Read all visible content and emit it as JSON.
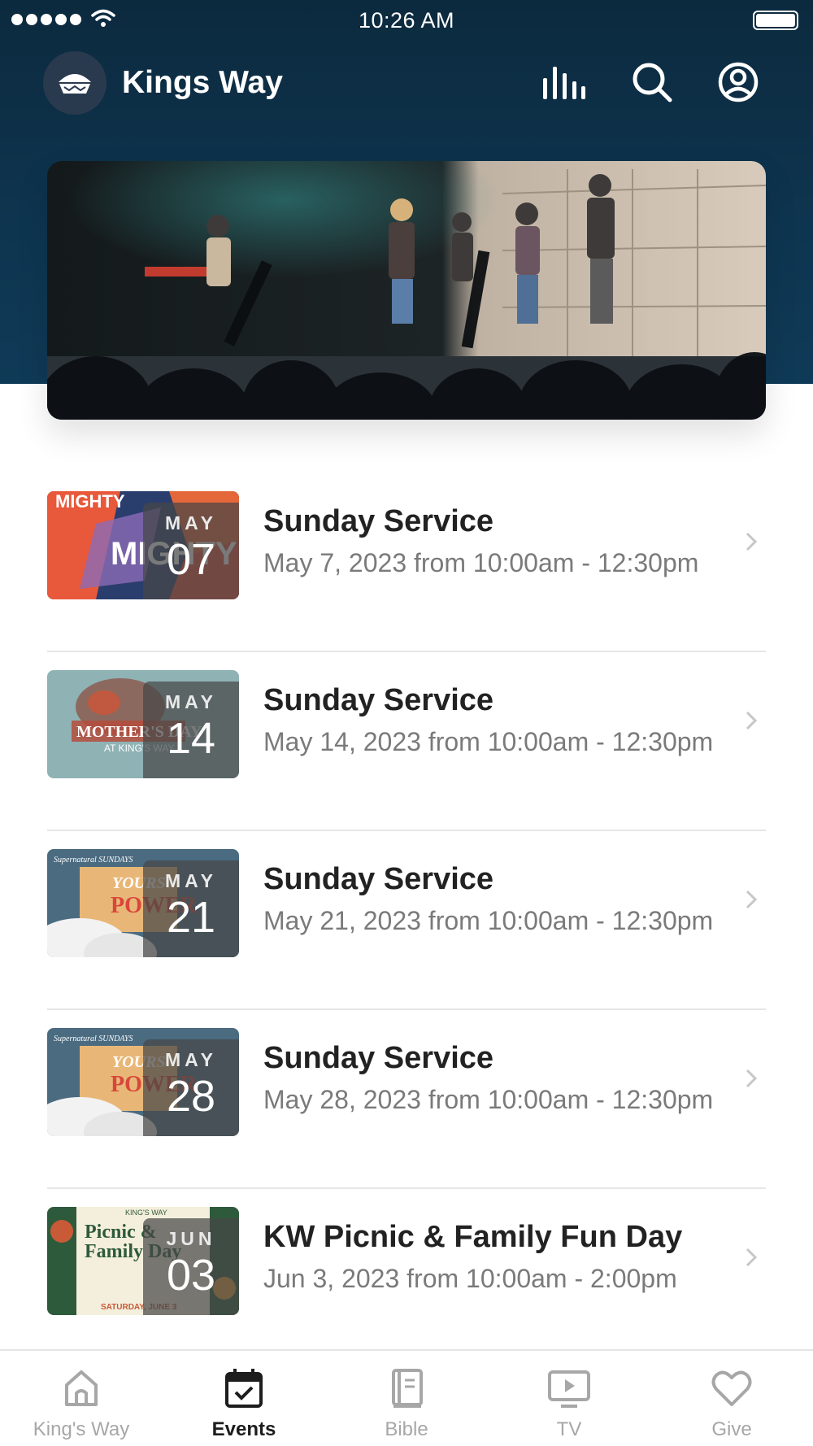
{
  "status_bar": {
    "time": "10:26 AM"
  },
  "app_bar": {
    "title": "Kings Way"
  },
  "events": [
    {
      "title": "Sunday Service",
      "subtitle": "May 7, 2023 from 10:00am - 12:30pm",
      "month": "MAY",
      "day": "07",
      "thumb": "mighty"
    },
    {
      "title": "Sunday Service",
      "subtitle": "May 14, 2023 from 10:00am - 12:30pm",
      "month": "MAY",
      "day": "14",
      "thumb": "mothers-day"
    },
    {
      "title": "Sunday Service",
      "subtitle": "May 21, 2023 from 10:00am - 12:30pm",
      "month": "MAY",
      "day": "21",
      "thumb": "yours-is-the-power"
    },
    {
      "title": "Sunday Service",
      "subtitle": "May 28, 2023 from 10:00am - 12:30pm",
      "month": "MAY",
      "day": "28",
      "thumb": "yours-is-the-power"
    },
    {
      "title": "KW Picnic & Family Fun Day",
      "subtitle": "Jun 3, 2023 from 10:00am - 2:00pm",
      "month": "JUN",
      "day": "03",
      "thumb": "picnic"
    }
  ],
  "thumb_text": {
    "mighty": "MIGHTY",
    "mothers_day_a": "MOTHER'S DAY",
    "mothers_day_b": "AT KING'S WAY",
    "supernatural": "Supernatural SUNDAYS",
    "yours": "YOURS",
    "power": "POWER",
    "kings_way": "KING'S WAY",
    "picnic_a": "Picnic &",
    "picnic_b": "Family Day",
    "picnic_c": "SATURDAY, JUNE 3"
  },
  "tabs": [
    {
      "label": "King's Way",
      "icon": "home-icon",
      "active": false
    },
    {
      "label": "Events",
      "icon": "calendar-icon",
      "active": true
    },
    {
      "label": "Bible",
      "icon": "book-icon",
      "active": false
    },
    {
      "label": "TV",
      "icon": "tv-icon",
      "active": false
    },
    {
      "label": "Give",
      "icon": "heart-icon",
      "active": false
    }
  ],
  "colors": {
    "header": "#0e3550",
    "active_tab": "#1d1d1d",
    "inactive_tab": "#a7a7a7"
  }
}
